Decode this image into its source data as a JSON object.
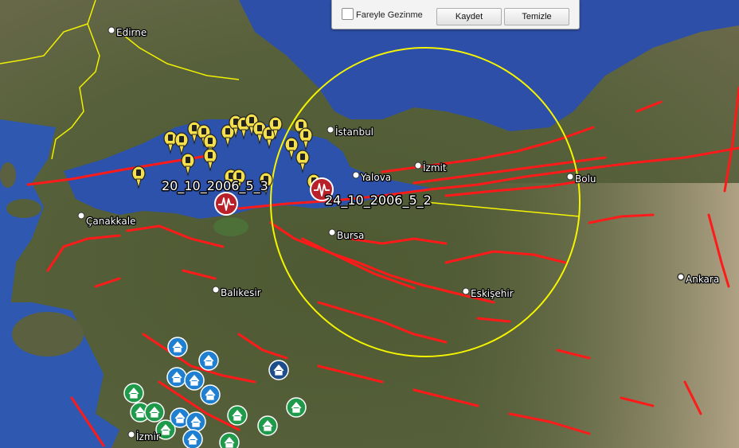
{
  "toolbar": {
    "mouse_nav_label": "Fareyle Gezinme",
    "mouse_nav_checked": false,
    "save_label": "Kaydet",
    "clear_label": "Temizle"
  },
  "cities": [
    {
      "id": "edirne",
      "name": "Edirne"
    },
    {
      "id": "istanbul",
      "name": "İstanbul"
    },
    {
      "id": "yalova",
      "name": "Yalova"
    },
    {
      "id": "izmit",
      "name": "İzmit"
    },
    {
      "id": "bolu",
      "name": "Bolu"
    },
    {
      "id": "canakkale",
      "name": "Çanakkale"
    },
    {
      "id": "bursa",
      "name": "Bursa"
    },
    {
      "id": "balikesir",
      "name": "Balıkesir"
    },
    {
      "id": "eskisehir",
      "name": "Eskişehir"
    },
    {
      "id": "ankara",
      "name": "Ankara"
    },
    {
      "id": "izmir",
      "name": "İzmir"
    }
  ],
  "earthquakes": [
    {
      "id": "quake-1",
      "label": "20_10_2006_5_3"
    },
    {
      "id": "quake-2",
      "label": "24_10_2006_5_2"
    }
  ],
  "colors": {
    "fault_line": "#ff1a1a",
    "radius_circle": "#f5f500",
    "border_line": "#f0f000",
    "pin_yellow": "#f5e04a",
    "quake_marker": "#b8202a",
    "house_blue": "#1f7fd0",
    "house_green": "#1f9a4a",
    "house_navy": "#1d4e8a"
  },
  "icons": {
    "epicenter": "seismograph-icon",
    "pin": "pushpin-icon",
    "house": "house-icon",
    "city": "city-dot-icon"
  }
}
